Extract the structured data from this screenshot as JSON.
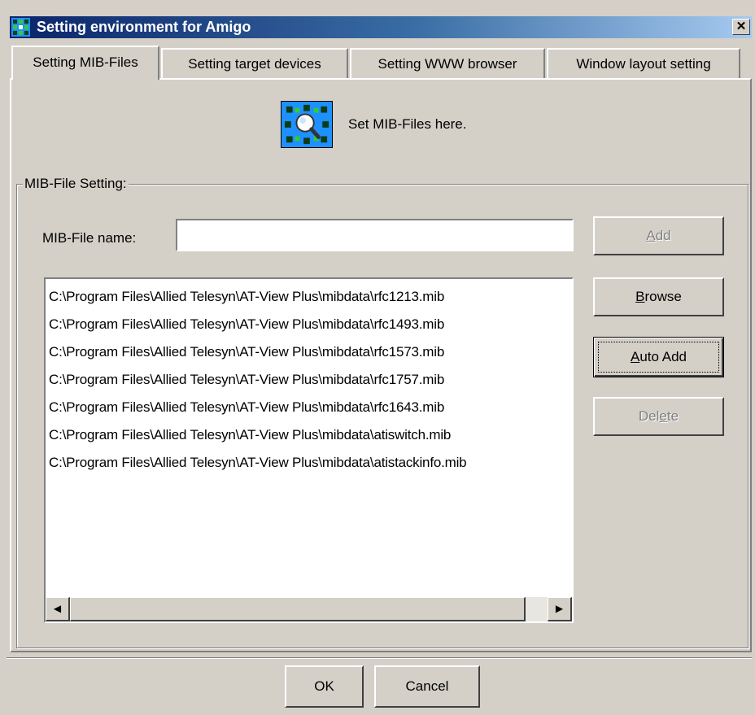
{
  "window": {
    "title": "Setting environment for Amigo",
    "close_glyph": "✕",
    "icon": "amigo-network-icon"
  },
  "tabs": [
    {
      "label": "Setting MIB-Files",
      "active": true
    },
    {
      "label": "Setting target devices",
      "active": false
    },
    {
      "label": "Setting WWW browser",
      "active": false
    },
    {
      "label": "Window layout setting",
      "active": false
    }
  ],
  "banner": {
    "icon": "mib-search-icon",
    "text": "Set MIB-Files here."
  },
  "group": {
    "label": "MIB-File Setting:",
    "field_label": "MIB-File name:",
    "field_value": "",
    "files": [
      "C:\\Program Files\\Allied Telesyn\\AT-View Plus\\mibdata\\rfc1213.mib",
      "C:\\Program Files\\Allied Telesyn\\AT-View Plus\\mibdata\\rfc1493.mib",
      "C:\\Program Files\\Allied Telesyn\\AT-View Plus\\mibdata\\rfc1573.mib",
      "C:\\Program Files\\Allied Telesyn\\AT-View Plus\\mibdata\\rfc1757.mib",
      "C:\\Program Files\\Allied Telesyn\\AT-View Plus\\mibdata\\rfc1643.mib",
      "C:\\Program Files\\Allied Telesyn\\AT-View Plus\\mibdata\\atiswitch.mib",
      "C:\\Program Files\\Allied Telesyn\\AT-View Plus\\mibdata\\atistackinfo.mib"
    ]
  },
  "buttons": {
    "add": {
      "pre": "",
      "accel": "A",
      "post": "dd",
      "enabled": false
    },
    "browse": {
      "pre": "",
      "accel": "B",
      "post": "rowse",
      "enabled": true
    },
    "auto_add": {
      "pre": "",
      "accel": "A",
      "post": "uto Add",
      "enabled": true
    },
    "delete": {
      "pre": "Del",
      "accel": "e",
      "post": "te",
      "enabled": false
    },
    "ok": "OK",
    "cancel": "Cancel"
  },
  "scrollbar": {
    "left_glyph": "◀",
    "right_glyph": "▶"
  },
  "colors": {
    "titlebar_start": "#0a246a",
    "titlebar_end": "#a6caf0",
    "face": "#d4d0c8",
    "banner_icon_bg": "#1e90ff"
  }
}
